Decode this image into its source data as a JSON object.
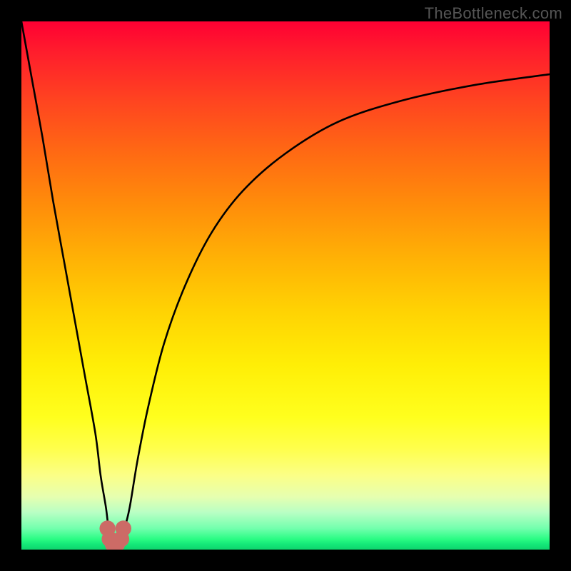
{
  "watermark": "TheBottleneck.com",
  "chart_data": {
    "type": "line",
    "title": "",
    "xlabel": "",
    "ylabel": "",
    "xlim": [
      0,
      100
    ],
    "ylim": [
      0,
      100
    ],
    "series": [
      {
        "name": "bottleneck-curve",
        "x": [
          0,
          2,
          4,
          6,
          8,
          10,
          12,
          14,
          15,
          16,
          16.5,
          17,
          17.5,
          18.5,
          19.5,
          20.5,
          22,
          24,
          27,
          31,
          36,
          42,
          50,
          60,
          72,
          86,
          100
        ],
        "values": [
          100,
          89,
          78,
          66,
          55,
          44,
          33,
          22,
          14,
          8,
          4,
          2,
          2,
          2,
          4,
          8,
          17,
          27,
          39,
          50,
          60,
          68,
          75,
          81,
          85,
          88,
          90
        ]
      }
    ],
    "markers": [
      {
        "name": "min-left-cap",
        "x": 16.3,
        "y": 4,
        "r": 1.4,
        "color": "#cc6b66"
      },
      {
        "name": "min-left",
        "x": 16.7,
        "y": 2,
        "r": 1.4,
        "color": "#cc6b66"
      },
      {
        "name": "min-center-1",
        "x": 17.3,
        "y": 1,
        "r": 1.4,
        "color": "#cc6b66"
      },
      {
        "name": "min-center-2",
        "x": 18.1,
        "y": 1,
        "r": 1.4,
        "color": "#cc6b66"
      },
      {
        "name": "min-right",
        "x": 18.9,
        "y": 2,
        "r": 1.4,
        "color": "#cc6b66"
      },
      {
        "name": "min-right-cap",
        "x": 19.3,
        "y": 4,
        "r": 1.4,
        "color": "#cc6b66"
      }
    ],
    "gradient_stops": [
      {
        "pos": 0,
        "color": "#ff0033"
      },
      {
        "pos": 25,
        "color": "#ff6a13"
      },
      {
        "pos": 55,
        "color": "#ffd303"
      },
      {
        "pos": 81,
        "color": "#ffff4d"
      },
      {
        "pos": 100,
        "color": "#0fd46e"
      }
    ]
  }
}
